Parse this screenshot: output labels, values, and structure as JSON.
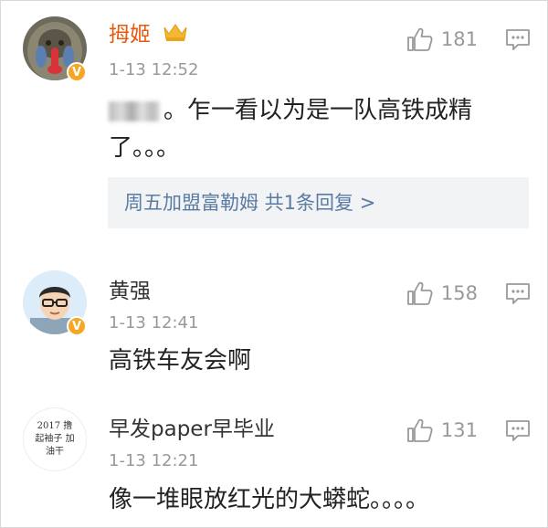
{
  "comments": [
    {
      "author": "拇姬",
      "time": "1-13 12:52",
      "blurred_text": "",
      "text_line1": "。乍一看以为是一队高铁成精",
      "text_line2": "了。。。",
      "likes": "181",
      "reply_summary": "周五加盟富勒姆  共1条回复 >",
      "avatar_icon": "mandrill-avatar-icon"
    },
    {
      "author": "黄强",
      "time": "1-13 12:41",
      "text": "高铁车友会啊",
      "likes": "158",
      "avatar_icon": "cartoon-man-avatar-icon"
    },
    {
      "author": "早发paper早毕业",
      "time": "1-13 12:21",
      "text": "像一堆眼放红光的大蟒蛇。。。。",
      "likes": "131",
      "avatar_text": "2017 撸起袖子 加油干",
      "avatar_icon": "handwritten-avatar-icon"
    }
  ],
  "colors": {
    "vip_name": "#e8590c",
    "link": "#5a7ba3",
    "badge": "#f5a623"
  }
}
